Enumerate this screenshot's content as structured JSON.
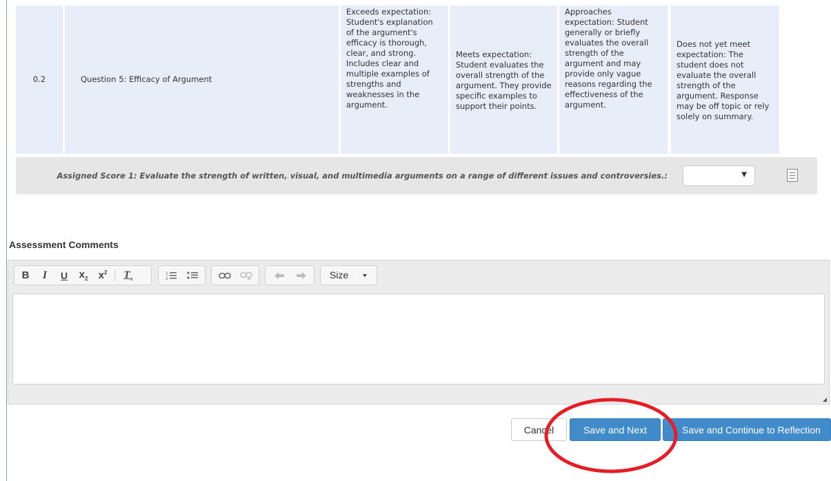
{
  "rubric": {
    "weight": "0.2",
    "criterion": "Question 5: Efficacy of Argument",
    "levels": {
      "exceeds": "Exceeds expectation: Student's explanation of the argument's efficacy is thorough, clear, and strong. Includes clear and multiple examples of strengths and weaknesses in the argument.",
      "meets": "Meets expectation: Student evaluates the overall strength of the argument. They provide specific examples to support their points.",
      "approaches": "Approaches expectation: Student generally or briefly evaluates the overall strength of the argument and may provide only vague reasons regarding the effectiveness of the argument.",
      "not_yet": "Does not yet meet expectation: The student does not evaluate the overall strength of the argument. Response may be off topic or rely solely on summary."
    }
  },
  "assigned_score": {
    "label": "Assigned Score 1: Evaluate the strength of written, visual, and multimedia arguments on a range of different issues and controversies.:",
    "selected_value": "",
    "dropdown_icon": "caret-down-icon",
    "note_icon": "notepad-icon"
  },
  "comments": {
    "heading": "Assessment Comments",
    "value": "",
    "toolbar": {
      "bold": "B",
      "italic": "I",
      "underline": "U",
      "subscript": "x",
      "subscript_mark": "2",
      "superscript": "x",
      "superscript_mark": "2",
      "remove_format": "T",
      "remove_format_mark": "x",
      "size_label": "Size"
    }
  },
  "actions": {
    "cancel_label": "Cancel",
    "save_next_label": "Save and Next",
    "save_reflection_label": "Save and Continue to Reflection"
  },
  "colors": {
    "rubric_cell_bg": "#e7eefa",
    "primary_button": "#428bca",
    "highlight_ring": "#e41e26"
  }
}
